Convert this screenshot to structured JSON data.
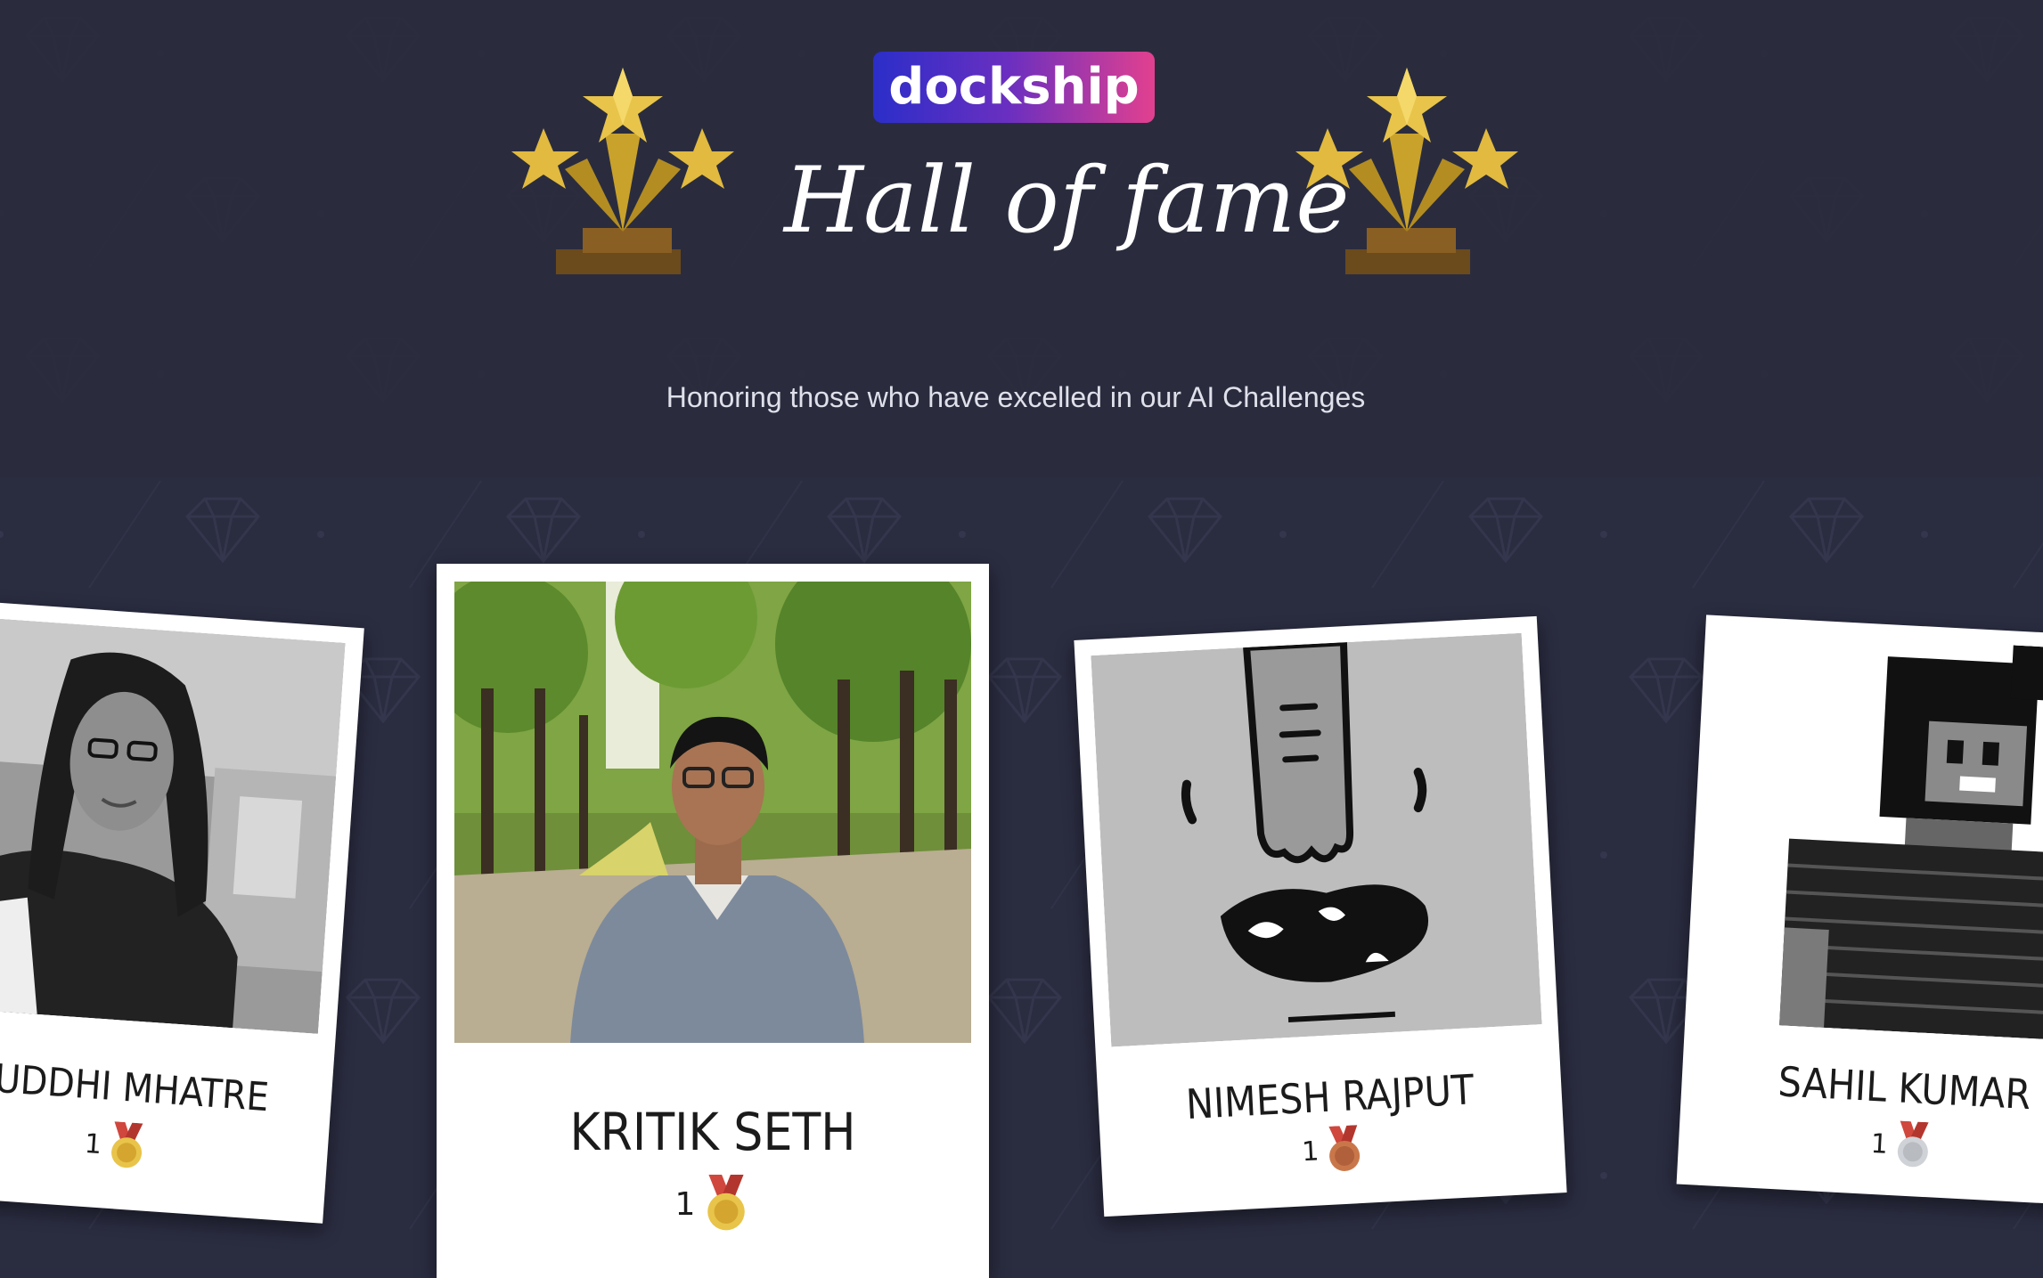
{
  "header": {
    "logo_text": "dockship",
    "title": "Hall of fame",
    "subtitle": "Honoring those who have excelled in our AI Challenges"
  },
  "icons": {
    "trophy": "trophy-stars-icon",
    "medal_gold": "gold-medal-icon",
    "medal_bronze": "bronze-medal-icon",
    "medal_silver": "silver-medal-icon"
  },
  "colors": {
    "background": "#2a2c40",
    "logo_gradient_start": "#2b2ec9",
    "logo_gradient_end": "#e2408f",
    "gold": "#e8c44a",
    "bronze": "#c9774a",
    "silver": "#cfd2d6",
    "ribbon": "#d0473d"
  },
  "winners": [
    {
      "name": "RUDDHI MHATRE",
      "medal_count": "1",
      "medal": "gold"
    },
    {
      "name": "KRITIK SETH",
      "medal_count": "1",
      "medal": "gold"
    },
    {
      "name": "NIMESH RAJPUT",
      "medal_count": "1",
      "medal": "bronze"
    },
    {
      "name": "SAHIL KUMAR",
      "medal_count": "1",
      "medal": "silver"
    }
  ]
}
